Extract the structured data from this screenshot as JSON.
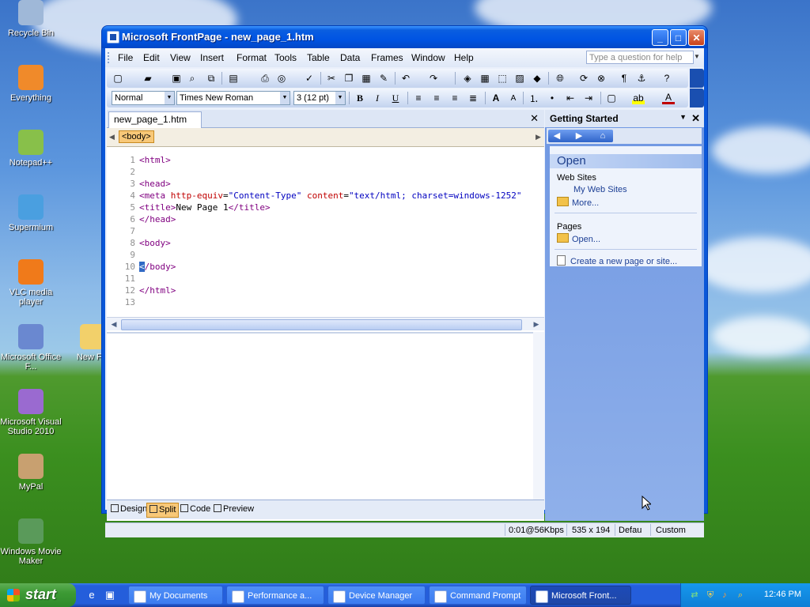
{
  "desktop": {
    "icons": [
      {
        "label": "Recycle Bin",
        "icon": "recycle-bin-icon"
      },
      {
        "label": "Everything",
        "icon": "everything-icon"
      },
      {
        "label": "Notepad++",
        "icon": "notepad-plus-plus-icon"
      },
      {
        "label": "Supermium",
        "icon": "browser-icon"
      },
      {
        "label": "VLC media player",
        "icon": "vlc-icon"
      },
      {
        "label": "Microsoft Office F...",
        "icon": "office-frontpage-icon"
      },
      {
        "label": "Microsoft Visual Studio 2010",
        "icon": "visual-studio-icon"
      },
      {
        "label": "MyPal",
        "icon": "mypal-icon"
      },
      {
        "label": "Windows Movie Maker",
        "icon": "movie-maker-icon"
      },
      {
        "label": "New Fol",
        "icon": "folder-icon"
      }
    ]
  },
  "window": {
    "title": "Microsoft FrontPage - new_page_1.htm",
    "controls": {
      "minimize": "_",
      "maximize": "□",
      "close": "✕"
    }
  },
  "menubar": {
    "items": [
      "File",
      "Edit",
      "View",
      "Insert",
      "Format",
      "Tools",
      "Table",
      "Data",
      "Frames",
      "Window",
      "Help"
    ],
    "ask_placeholder": "Type a question for help"
  },
  "formatting": {
    "style": "Normal",
    "font": "Times New Roman",
    "size": "3 (12 pt)",
    "bold": "B",
    "italic": "I",
    "underline": "U"
  },
  "document": {
    "tab_name": "new_page_1.htm",
    "quick_tag": "<body>",
    "code_lines": [
      {
        "n": "1",
        "html": "<span class=\"tagc\">&lt;html&gt;</span>"
      },
      {
        "n": "2",
        "html": ""
      },
      {
        "n": "3",
        "html": "<span class=\"tagc\">&lt;head&gt;</span>"
      },
      {
        "n": "4",
        "html": "<span class=\"tagc\">&lt;meta</span> <span class=\"attrc\">http-equiv</span>=<span class=\"valc\">\"Content-Type\"</span> <span class=\"attrc\">content</span>=<span class=\"valc\">\"text/html; charset=windows-1252\"</span>"
      },
      {
        "n": "5",
        "html": "<span class=\"tagc\">&lt;title&gt;</span>New Page 1<span class=\"tagc\">&lt;/title&gt;</span>"
      },
      {
        "n": "6",
        "html": "<span class=\"tagc\">&lt;/head&gt;</span>"
      },
      {
        "n": "7",
        "html": ""
      },
      {
        "n": "8",
        "html": "<span class=\"tagc\">&lt;body&gt;</span>"
      },
      {
        "n": "9",
        "html": ""
      },
      {
        "n": "10",
        "html": "<span class=\"tagc\" style=\"background:#316ac5;color:#fff\">&lt;</span><span class=\"tagc\">/body&gt;</span>"
      },
      {
        "n": "11",
        "html": ""
      },
      {
        "n": "12",
        "html": "<span class=\"tagc\">&lt;/html&gt;</span>"
      },
      {
        "n": "13",
        "html": ""
      }
    ],
    "view_tabs": [
      "Design",
      "Split",
      "Code",
      "Preview"
    ],
    "selected_view": "Split"
  },
  "task_pane": {
    "title": "Getting Started",
    "section": "Open",
    "web_sites_label": "Web Sites",
    "my_web_sites": "My Web Sites",
    "more": "More...",
    "pages_label": "Pages",
    "open": "Open...",
    "create": "Create a new page or site..."
  },
  "status_bar": {
    "speed": "0:01@56Kbps",
    "dimensions": "535 x 194",
    "default": "Defau",
    "custom": "Custom"
  },
  "taskbar": {
    "start": "start",
    "tasks": [
      {
        "label": "My Documents",
        "active": false
      },
      {
        "label": "Performance a...",
        "active": false
      },
      {
        "label": "Device Manager",
        "active": false
      },
      {
        "label": "Command Prompt",
        "active": false
      },
      {
        "label": "Microsoft Front...",
        "active": true
      }
    ],
    "clock": "12:46 PM"
  }
}
